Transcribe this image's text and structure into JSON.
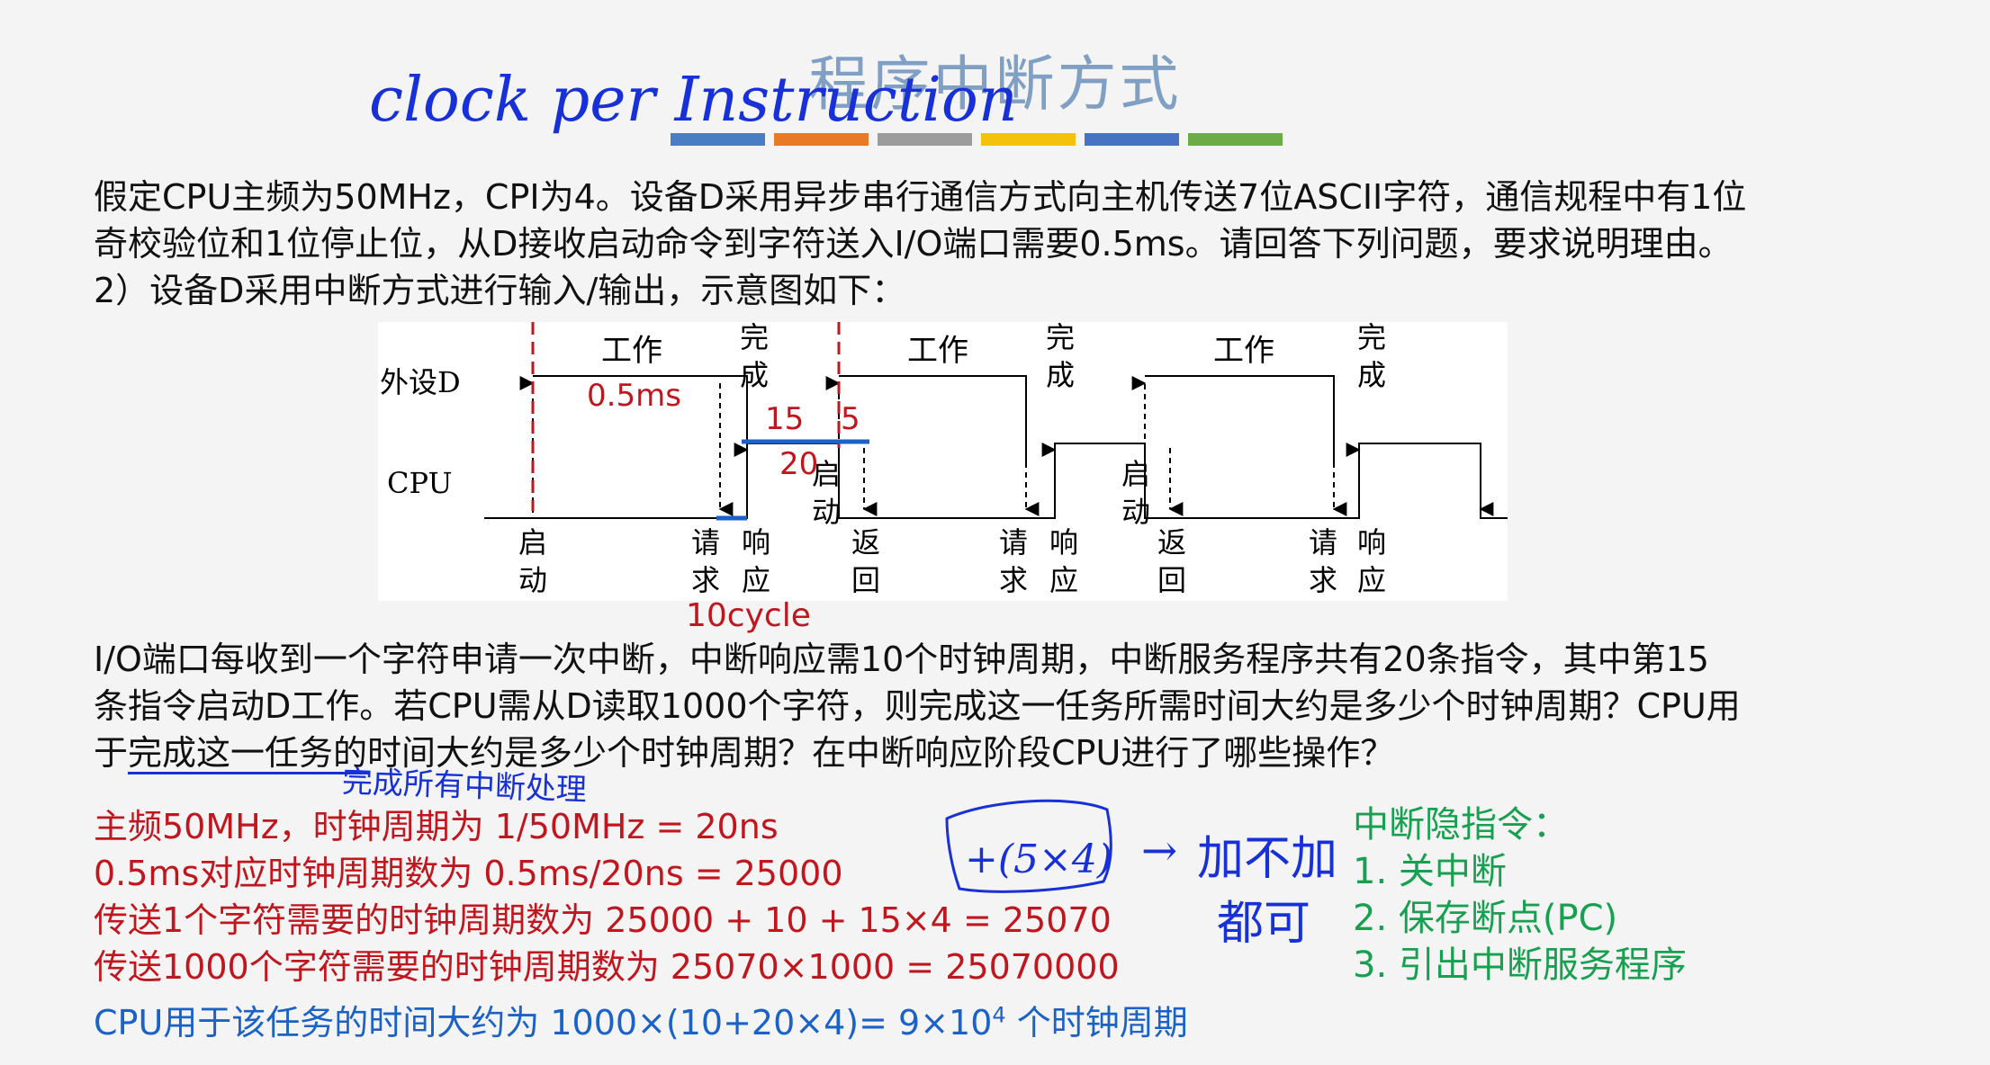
{
  "title": "程序中断方式",
  "accent_colors": [
    "#4a7ec2",
    "#e87a26",
    "#9c9c9c",
    "#f4c20d",
    "#4673c2",
    "#6cab45"
  ],
  "problem": {
    "line1": "假定CPU主频为50MHz，CPI为4。设备D采用异步串行通信方式向主机传送7位ASCII字符，通信规程中有1位",
    "line2": "奇校验位和1位停止位，从D接收启动命令到字符送入I/O端口需要0.5ms。请回答下列问题，要求说明理由。",
    "line3": "2）设备D采用中断方式进行输入/输出，示意图如下："
  },
  "diagram": {
    "peripheral_label": "外设D",
    "cpu_label": "CPU",
    "work": "工作",
    "done_1": "完",
    "done_2": "成",
    "start_1": "启",
    "start_2": "动",
    "request_1": "请",
    "request_2": "求",
    "respond_1": "响",
    "respond_2": "应",
    "return_1": "返",
    "return_2": "回",
    "annot_time": "0.5ms",
    "annot_15": "15",
    "annot_5": "5",
    "annot_20": "20",
    "annot_cycle": "10cycle"
  },
  "question": {
    "line1": "I/O端口每收到一个字符申请一次中断，中断响应需10个时钟周期，中断服务程序共有20条指令，其中第15",
    "line2": "条指令启动D工作。若CPU需从D读取1000个字符，则完成这一任务所需时间大约是多少个时钟周期？CPU用",
    "line3": "于完成这一任务的时间大约是多少个时钟周期？在中断响应阶段CPU进行了哪些操作？"
  },
  "answer": {
    "a1": "主频50MHz，时钟周期为 1/50MHz = 20ns",
    "a2": "0.5ms对应时钟周期数为 0.5ms/20ns = 25000",
    "a3": "传送1个字符需要的时钟周期数为 25000 + 10 + 15×4 = 25070",
    "a4": "传送1000个字符需要的时钟周期数为 25070×1000 = 25070000",
    "a5": "CPU用于该任务的时间大约为 1000×(10+20×4)= 9×10",
    "a5_sup": "4",
    "a5_tail": " 个时钟周期"
  },
  "hint": {
    "title": "中断隐指令：",
    "item1": "1. 关中断",
    "item2": "2. 保存断点(PC)",
    "item3": "3. 引出中断服务程序"
  },
  "handwriting": {
    "cpi": "clock per Instruction",
    "all": "完成所有中断处理",
    "plus": "+(5×4)",
    "either": "加不加",
    "ok": "都可"
  }
}
